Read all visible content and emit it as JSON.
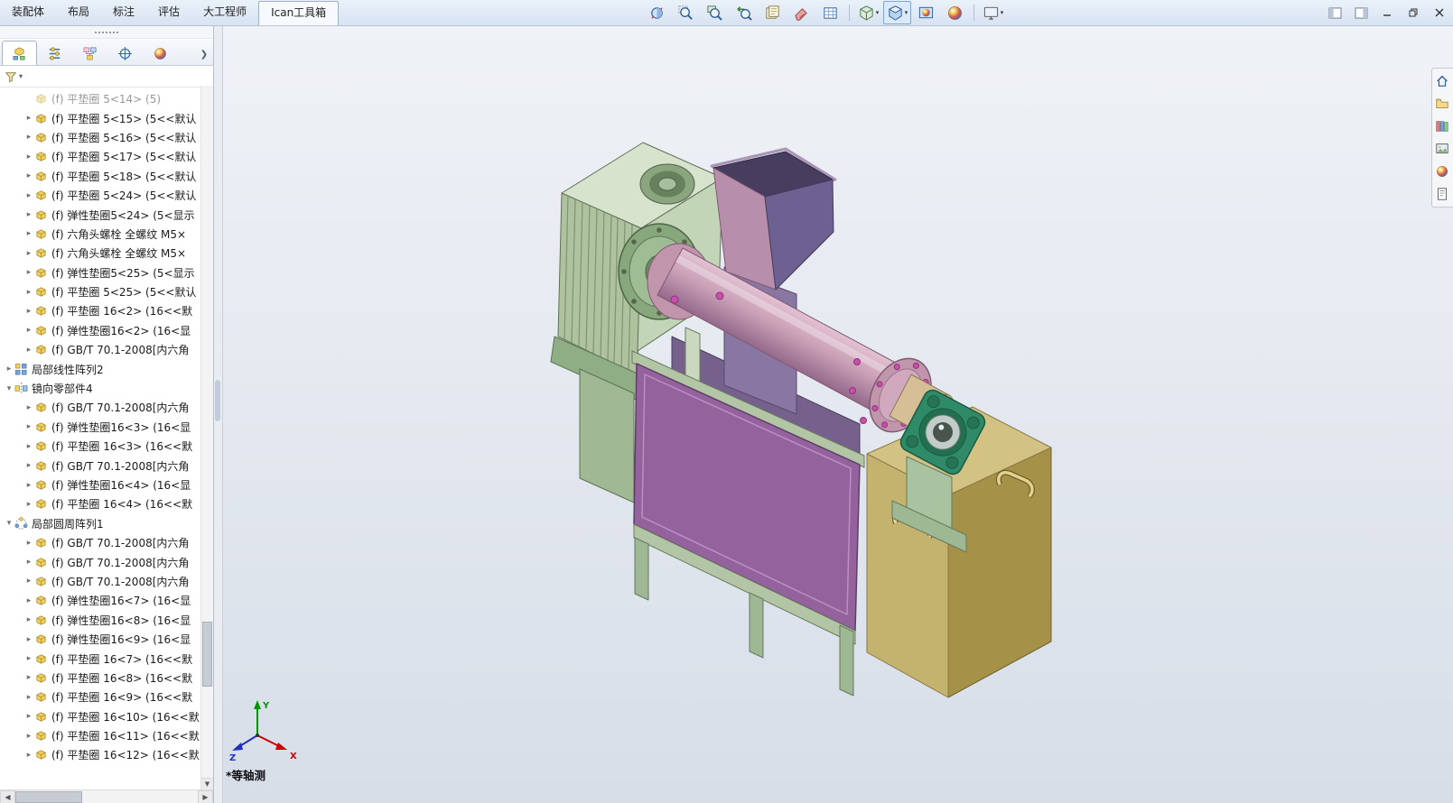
{
  "ribbon": {
    "tabs": [
      {
        "label": "装配体",
        "active": false
      },
      {
        "label": "布局",
        "active": false
      },
      {
        "label": "标注",
        "active": false
      },
      {
        "label": "评估",
        "active": false
      },
      {
        "label": "大工程师",
        "active": false
      },
      {
        "label": "Ican工具箱",
        "active": true
      }
    ]
  },
  "toolbar": {
    "items": [
      {
        "name": "section-view",
        "icon": "section"
      },
      {
        "name": "zoom-to-fit",
        "icon": "zoomfit"
      },
      {
        "name": "zoom-to-area",
        "icon": "zoomarea"
      },
      {
        "name": "previous-view",
        "icon": "prevview"
      },
      {
        "name": "apply-scene",
        "icon": "pages"
      },
      {
        "name": "edit-appearance",
        "icon": "eraser"
      },
      {
        "name": "display-states",
        "icon": "grid"
      },
      {
        "type": "sep"
      },
      {
        "name": "view-orientation",
        "icon": "cube",
        "dropdown": true
      },
      {
        "name": "display-style",
        "icon": "displaystyle",
        "dropdown": true,
        "active": true
      },
      {
        "name": "hide-show-items",
        "icon": "ball2"
      },
      {
        "name": "appearances",
        "icon": "ball"
      },
      {
        "type": "sep"
      },
      {
        "name": "view-settings",
        "icon": "monitor",
        "dropdown": true
      }
    ]
  },
  "window_controls": [
    "dock-left",
    "dock-right",
    "minimize",
    "restore",
    "close"
  ],
  "panel": {
    "tabs": [
      {
        "name": "featuremanager-tree",
        "icon": "fm",
        "active": true
      },
      {
        "name": "propertymanager",
        "icon": "pm",
        "active": false
      },
      {
        "name": "configurationmanager",
        "icon": "cm",
        "active": false
      },
      {
        "name": "dimxpertmanager",
        "icon": "dx",
        "active": false
      },
      {
        "name": "displaymanager",
        "icon": "dm",
        "active": false
      }
    ]
  },
  "tree": {
    "items": [
      {
        "level": 1,
        "arrow": "none",
        "icon": "part",
        "faded": true,
        "label": "(f) 平垫圈 5<14> (5)"
      },
      {
        "level": 1,
        "arrow": "collapsed",
        "icon": "part",
        "label": "(f) 平垫圈 5<15> (5<<默认"
      },
      {
        "level": 1,
        "arrow": "collapsed",
        "icon": "part",
        "label": "(f) 平垫圈 5<16> (5<<默认"
      },
      {
        "level": 1,
        "arrow": "collapsed",
        "icon": "part",
        "label": "(f) 平垫圈 5<17> (5<<默认"
      },
      {
        "level": 1,
        "arrow": "collapsed",
        "icon": "part",
        "label": "(f) 平垫圈 5<18> (5<<默认"
      },
      {
        "level": 1,
        "arrow": "collapsed",
        "icon": "part",
        "label": "(f) 平垫圈 5<24> (5<<默认"
      },
      {
        "level": 1,
        "arrow": "collapsed",
        "icon": "part",
        "label": "(f) 弹性垫圈5<24> (5<显示"
      },
      {
        "level": 1,
        "arrow": "collapsed",
        "icon": "part",
        "label": "(f) 六角头螺栓 全螺纹 M5×"
      },
      {
        "level": 1,
        "arrow": "collapsed",
        "icon": "part",
        "label": "(f) 六角头螺栓 全螺纹 M5×"
      },
      {
        "level": 1,
        "arrow": "collapsed",
        "icon": "part",
        "label": "(f) 弹性垫圈5<25> (5<显示"
      },
      {
        "level": 1,
        "arrow": "collapsed",
        "icon": "part",
        "label": "(f) 平垫圈 5<25> (5<<默认"
      },
      {
        "level": 1,
        "arrow": "collapsed",
        "icon": "part",
        "label": "(f) 平垫圈 16<2> (16<<默"
      },
      {
        "level": 1,
        "arrow": "collapsed",
        "icon": "part",
        "label": "(f) 弹性垫圈16<2> (16<显"
      },
      {
        "level": 1,
        "arrow": "collapsed",
        "icon": "part",
        "label": "(f) GB/T 70.1-2008[内六角"
      },
      {
        "level": 0,
        "arrow": "collapsed",
        "icon": "pattern-linear",
        "label": "局部线性阵列2"
      },
      {
        "level": 0,
        "arrow": "expanded",
        "icon": "mirror",
        "label": "镜向零部件4"
      },
      {
        "level": 1,
        "arrow": "collapsed",
        "icon": "part",
        "label": "(f) GB/T 70.1-2008[内六角"
      },
      {
        "level": 1,
        "arrow": "collapsed",
        "icon": "part",
        "label": "(f) 弹性垫圈16<3> (16<显"
      },
      {
        "level": 1,
        "arrow": "collapsed",
        "icon": "part",
        "label": "(f) 平垫圈 16<3> (16<<默"
      },
      {
        "level": 1,
        "arrow": "collapsed",
        "icon": "part",
        "label": "(f) GB/T 70.1-2008[内六角"
      },
      {
        "level": 1,
        "arrow": "collapsed",
        "icon": "part",
        "label": "(f) 弹性垫圈16<4> (16<显"
      },
      {
        "level": 1,
        "arrow": "collapsed",
        "icon": "part",
        "label": "(f) 平垫圈 16<4> (16<<默"
      },
      {
        "level": 0,
        "arrow": "expanded",
        "icon": "pattern-circular",
        "label": "局部圆周阵列1"
      },
      {
        "level": 1,
        "arrow": "collapsed",
        "icon": "part",
        "label": "(f) GB/T 70.1-2008[内六角"
      },
      {
        "level": 1,
        "arrow": "collapsed",
        "icon": "part",
        "label": "(f) GB/T 70.1-2008[内六角"
      },
      {
        "level": 1,
        "arrow": "collapsed",
        "icon": "part",
        "label": "(f) GB/T 70.1-2008[内六角"
      },
      {
        "level": 1,
        "arrow": "collapsed",
        "icon": "part",
        "label": "(f) 弹性垫圈16<7> (16<显"
      },
      {
        "level": 1,
        "arrow": "collapsed",
        "icon": "part",
        "label": "(f) 弹性垫圈16<8> (16<显"
      },
      {
        "level": 1,
        "arrow": "collapsed",
        "icon": "part",
        "label": "(f) 弹性垫圈16<9> (16<显"
      },
      {
        "level": 1,
        "arrow": "collapsed",
        "icon": "part",
        "label": "(f) 平垫圈 16<7> (16<<默"
      },
      {
        "level": 1,
        "arrow": "collapsed",
        "icon": "part",
        "label": "(f) 平垫圈 16<8> (16<<默"
      },
      {
        "level": 1,
        "arrow": "collapsed",
        "icon": "part",
        "label": "(f) 平垫圈 16<9> (16<<默"
      },
      {
        "level": 1,
        "arrow": "collapsed",
        "icon": "part",
        "label": "(f) 平垫圈 16<10> (16<<默"
      },
      {
        "level": 1,
        "arrow": "collapsed",
        "icon": "part",
        "label": "(f) 平垫圈 16<11> (16<<默"
      },
      {
        "level": 1,
        "arrow": "collapsed",
        "icon": "part",
        "label": "(f) 平垫圈 16<12> (16<<默"
      }
    ]
  },
  "task_pane": {
    "items": [
      {
        "name": "home",
        "icon": "home"
      },
      {
        "name": "file-explorer",
        "icon": "folder"
      },
      {
        "name": "design-library",
        "icon": "library"
      },
      {
        "name": "view-palette",
        "icon": "palette"
      },
      {
        "name": "appearances",
        "icon": "ballsm"
      },
      {
        "name": "custom-properties",
        "icon": "props"
      }
    ]
  },
  "viewport": {
    "view_label": "*等轴测",
    "axis": {
      "x": "X",
      "y": "Y",
      "z": "Z"
    }
  },
  "colors": {
    "axis_x": "#cc0000",
    "axis_y": "#009900",
    "axis_z": "#2233bb",
    "model_gearbox": "#c3d5b7",
    "model_barrel": "#c99fb6",
    "model_hopper": "#6c6190",
    "model_panel": "#94639e",
    "model_frame": "#b2c6a5",
    "model_cabinet": "#c4b26f",
    "model_bearing": "#2f8a68"
  }
}
